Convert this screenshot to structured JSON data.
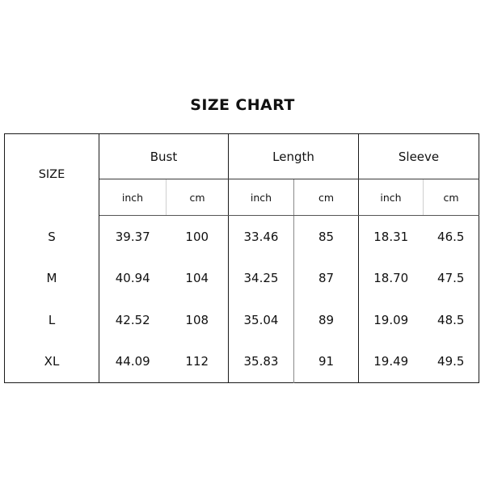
{
  "title": "SIZE CHART",
  "table": {
    "size_header": "SIZE",
    "groups": [
      "Bust",
      "Length",
      "Sleeve"
    ],
    "units": [
      "inch",
      "cm"
    ],
    "sub_headers": [
      "inch",
      "cm",
      "inch",
      "cm",
      "inch",
      "cm"
    ],
    "rows": [
      {
        "size": "S",
        "bust_inch": "39.37",
        "bust_cm": "100",
        "length_inch": "33.46",
        "length_cm": "85",
        "sleeve_inch": "18.31",
        "sleeve_cm": "46.5"
      },
      {
        "size": "M",
        "bust_inch": "40.94",
        "bust_cm": "104",
        "length_inch": "34.25",
        "length_cm": "87",
        "sleeve_inch": "18.70",
        "sleeve_cm": "47.5"
      },
      {
        "size": "L",
        "bust_inch": "42.52",
        "bust_cm": "108",
        "length_inch": "35.04",
        "length_cm": "89",
        "sleeve_inch": "19.09",
        "sleeve_cm": "48.5"
      },
      {
        "size": "XL",
        "bust_inch": "44.09",
        "bust_cm": "112",
        "length_inch": "35.83",
        "length_cm": "91",
        "sleeve_inch": "19.49",
        "sleeve_cm": "49.5"
      }
    ]
  },
  "colors": {
    "border": "#1a1a1a",
    "text": "#111111",
    "background": "#ffffff",
    "inner_rule": "#8a8a8a"
  }
}
